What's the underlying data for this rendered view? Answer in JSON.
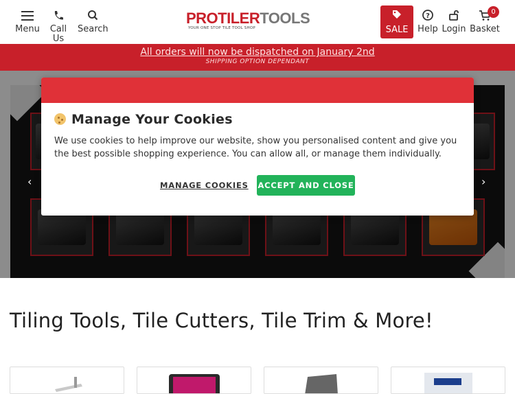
{
  "header": {
    "menu_label": "Menu",
    "call_label": "Call Us",
    "search_label": "Search",
    "logo_pro": "PROTILER",
    "logo_tools": "TOOLS",
    "logo_tagline": "YOUR ONE STOP TILE TOOL SHOP",
    "sale_label": "SALE",
    "help_label": "Help",
    "login_label": "Login",
    "basket_label": "Basket",
    "basket_count": "0"
  },
  "announcement": {
    "line1": "All orders will now be dispatched on January 2nd",
    "line2": "SHIPPING OPTION DEPENDANT"
  },
  "cookie_modal": {
    "title": "Manage Your Cookies",
    "body": "We use cookies to help improve our website, show you personalised content and give you the best possible shopping experience. You can allow all, or manage them individually.",
    "manage_label": "MANAGE COOKIES",
    "accept_label": "ACCEPT AND CLOSE"
  },
  "hero": {
    "prev_icon": "chevron-left-icon",
    "next_icon": "chevron-right-icon"
  },
  "main": {
    "heading": "Tiling Tools, Tile Cutters, Tile Trim & More!"
  },
  "colors": {
    "brand_red": "#c8202a",
    "modal_bar_red": "#e03138",
    "accept_green": "#22b35a"
  }
}
